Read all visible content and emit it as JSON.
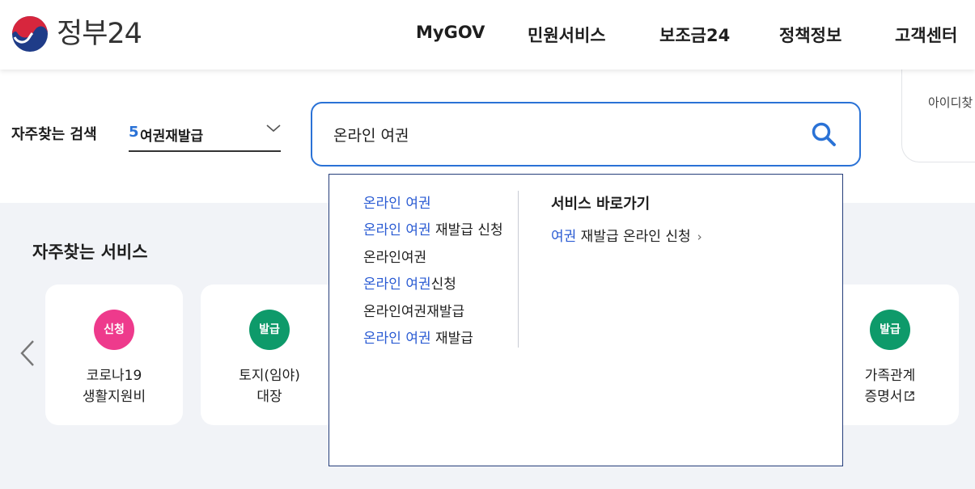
{
  "header": {
    "logo_text": "정부24",
    "nav": [
      "MyGOV",
      "민원서비스",
      "보조금24",
      "정책정보",
      "고객센터"
    ]
  },
  "search": {
    "frequent_label": "자주찾는 검색",
    "frequent_rank": "5",
    "frequent_value": "여권재발급",
    "query": "온라인 여권"
  },
  "login_card": {
    "text": "아이디찾"
  },
  "autocomplete": {
    "suggestions": [
      {
        "hl": "온라인 여권",
        "rest": ""
      },
      {
        "hl": "온라인 여권",
        "rest": " 재발급 신청"
      },
      {
        "hl": "",
        "rest": "온라인여권"
      },
      {
        "hl": "온라인 여권",
        "rest": "신청"
      },
      {
        "hl": "",
        "rest": "온라인여권재발급"
      },
      {
        "hl": "온라인 여권",
        "rest": " 재발급"
      }
    ],
    "shortcut_title": "서비스 바로가기",
    "shortcut_hl": "여권",
    "shortcut_rest": " 재발급 온라인 신청",
    "shortcut_chevron": "›"
  },
  "services": {
    "title": "자주찾는 서비스",
    "cards": [
      {
        "badge": "신청",
        "badge_color": "#ee3a8c",
        "line1": "코로나19",
        "line2": "생활지원비"
      },
      {
        "badge": "발급",
        "badge_color": "#0e9a6a",
        "line1": "토지(임야)",
        "line2": "대장"
      },
      {
        "badge": "발급",
        "badge_color": "#0e9a6a",
        "line1": "가족관계",
        "line2": "증명서"
      }
    ]
  },
  "colors": {
    "accent": "#2a72d6",
    "highlight": "#2a5bd3",
    "badge_pink": "#ee3a8c",
    "badge_green": "#0e9a6a"
  }
}
